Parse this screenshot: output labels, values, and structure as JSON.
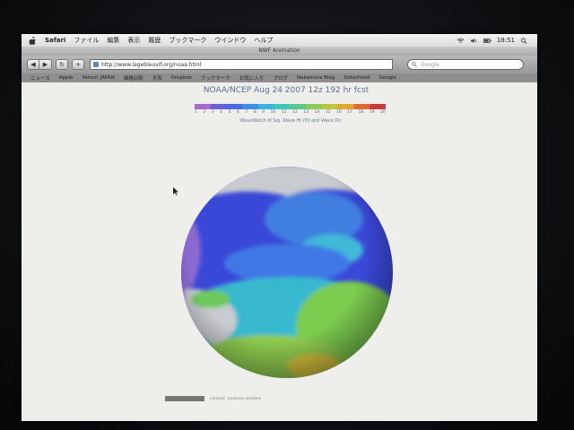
{
  "menubar": {
    "app": "Safari",
    "items": [
      "ファイル",
      "編集",
      "表示",
      "履歴",
      "ブックマーク",
      "ウインドウ",
      "ヘルプ"
    ],
    "clock": "18:51"
  },
  "window": {
    "title": "NWF Animation"
  },
  "toolbar": {
    "url": "http://www.lagebleuvif.org/noaa.html",
    "search_placeholder": "Google",
    "back_glyph": "◀",
    "forward_glyph": "▶",
    "reload_glyph": "↻",
    "add_glyph": "+"
  },
  "bookmarks": [
    "ニュース",
    "Apple",
    "Yahoo! JAPAN",
    "価格比較",
    "天気",
    "Dropbox",
    "ブックマーク",
    "お気に入り",
    "ブログ",
    "Nakamura Blog",
    "Sisterhood",
    "Google"
  ],
  "page": {
    "title": "NOAA/NCEP Aug 24 2007 12z 192 hr fcst",
    "colorbar_ticks": [
      "1",
      "2",
      "3",
      "4",
      "5",
      "6",
      "7",
      "8",
      "9",
      "10",
      "11",
      "12",
      "13",
      "14",
      "15",
      "16",
      "17",
      "18",
      "19",
      "20"
    ],
    "legend_note": "WaveWatch III Sig. Wave Ht (ft) and Wave Dir",
    "footer_text": "contact: analysis weather",
    "palette": [
      "#a46cc8",
      "#6d5fd6",
      "#4b6ae0",
      "#3e8fe6",
      "#39b4e0",
      "#3fc7b8",
      "#57c98a",
      "#8acb55",
      "#bfc83a",
      "#e0a933",
      "#e06a32",
      "#c93a3a"
    ]
  },
  "colors": {
    "ocean_deep": "#3a48d8",
    "ocean_mid": "#3f7fe0",
    "land_gray": "#c8cbcf",
    "warm_green": "#7ccc4f",
    "warm_yellow": "#d6c23a"
  }
}
